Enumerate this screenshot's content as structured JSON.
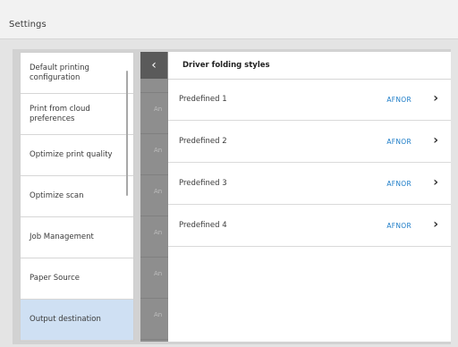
{
  "header": {
    "title": "Settings"
  },
  "sidebar": {
    "items": [
      {
        "label": "Default printing configuration",
        "selected": false
      },
      {
        "label": "Print from cloud preferences",
        "selected": false
      },
      {
        "label": "Optimize print quality",
        "selected": false
      },
      {
        "label": "Optimize scan",
        "selected": false
      },
      {
        "label": "Job Management",
        "selected": false
      },
      {
        "label": "Paper Source",
        "selected": false
      },
      {
        "label": "Output destination",
        "selected": true
      }
    ]
  },
  "shadow_panel": {
    "rows": [
      "An",
      "An",
      "An",
      "An",
      "An",
      "An",
      "An"
    ]
  },
  "back_button": {
    "icon": "chevron-left-icon",
    "glyph": "‹"
  },
  "detail": {
    "title": "Driver folding styles",
    "rows": [
      {
        "label": "Predefined 1",
        "value": "AFNOR",
        "icon": "chevron-right-icon",
        "glyph": "›"
      },
      {
        "label": "Predefined 2",
        "value": "AFNOR",
        "icon": "chevron-right-icon",
        "glyph": "›"
      },
      {
        "label": "Predefined 3",
        "value": "AFNOR",
        "icon": "chevron-right-icon",
        "glyph": "›"
      },
      {
        "label": "Predefined 4",
        "value": "AFNOR",
        "icon": "chevron-right-icon",
        "glyph": "›"
      }
    ]
  },
  "colors": {
    "accent": "#1e7dc8",
    "selected_bg": "#cfe0f3",
    "shadow_panel": "#8e8e8e",
    "back_button": "#5a5a5a"
  }
}
